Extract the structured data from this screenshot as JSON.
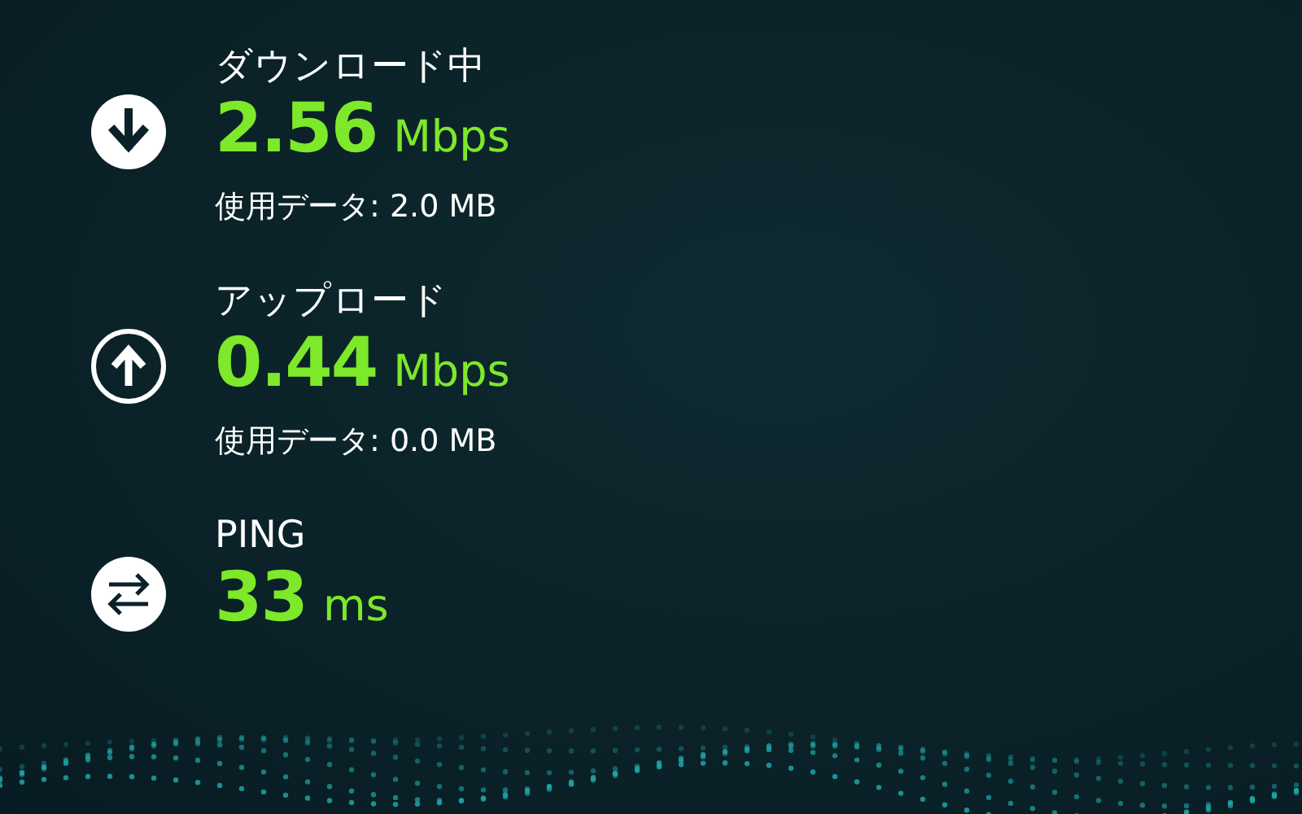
{
  "metrics": [
    {
      "kind": "download",
      "label": "ダウンロード中",
      "value": "2.56",
      "unit": "Mbps",
      "usage": "使用データ: 2.0 MB"
    },
    {
      "kind": "upload",
      "label": "アップロード",
      "value": "0.44",
      "unit": "Mbps",
      "usage": "使用データ: 0.0 MB"
    },
    {
      "kind": "ping",
      "label": "PING",
      "value": "33",
      "unit": "ms"
    }
  ]
}
